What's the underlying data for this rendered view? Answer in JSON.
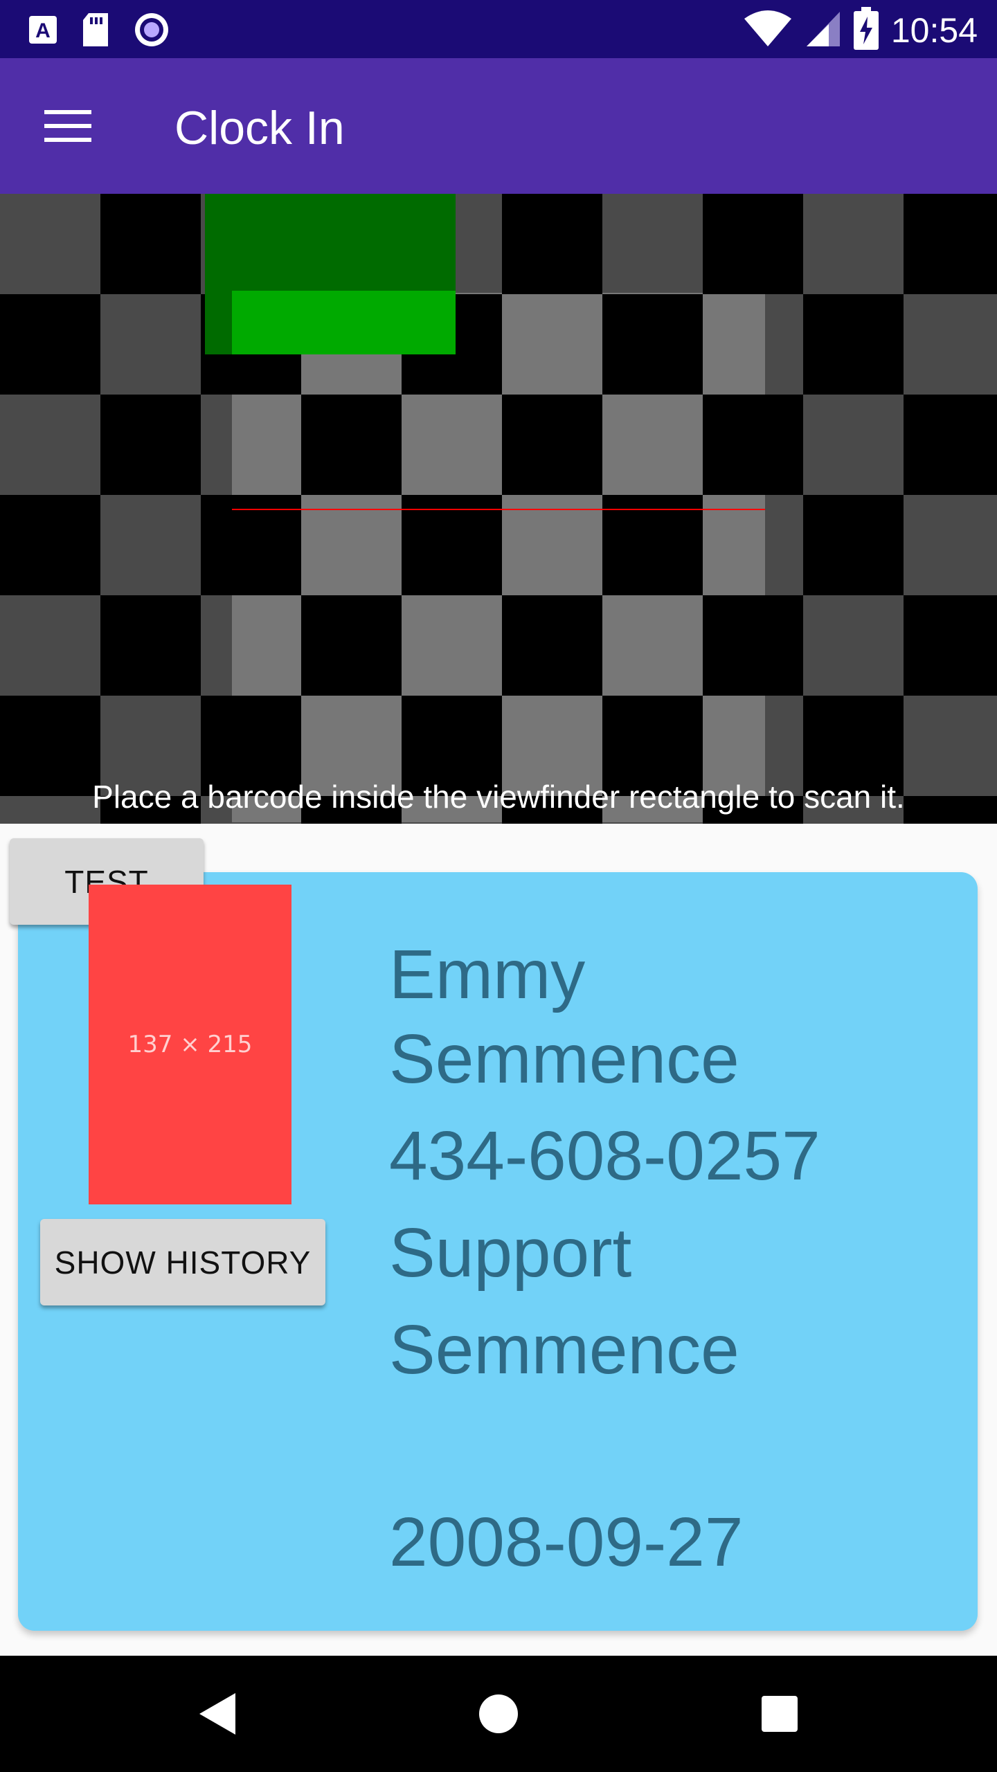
{
  "status_bar": {
    "time": "10:54",
    "left_icons": [
      "a-notification-icon",
      "sd-card-icon",
      "radio-icon"
    ],
    "right_icons": [
      "wifi-icon",
      "signal-icon",
      "battery-charging-icon"
    ]
  },
  "app_bar": {
    "title": "Clock In",
    "menu_icon": "menu-icon"
  },
  "scanner": {
    "hint": "Place a barcode inside the viewfinder rectangle to scan it.",
    "laser_color": "#ff0000",
    "found_point_color": "#00aa00"
  },
  "buttons": {
    "test_label": "TEST",
    "history_label": "SHOW HISTORY"
  },
  "employee": {
    "photo_placeholder": "137 × 215",
    "first_name": "Emmy",
    "last_name": "Semmence",
    "phone": "434-608-0257",
    "department": "Support",
    "manager": "Semmence",
    "date": "2008-09-27"
  },
  "colors": {
    "status_bar": "#1b0b75",
    "app_bar": "#502ea8",
    "card": "#72d2f8",
    "card_text": "#2e6a86",
    "photo": "#ff4444"
  },
  "nav_bar": {
    "back_icon": "back-icon",
    "home_icon": "home-icon",
    "recents_icon": "recents-icon"
  }
}
